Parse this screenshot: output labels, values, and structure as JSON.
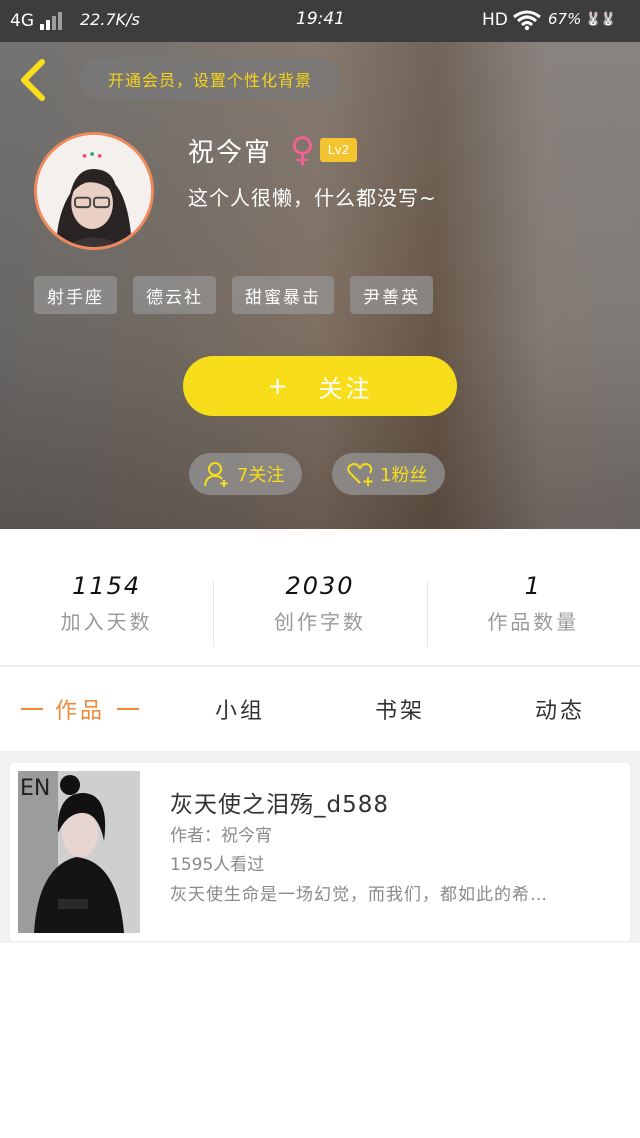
{
  "status_bar": {
    "network": "4G",
    "speed": "22.7K/s",
    "time": "19:41",
    "hd": "HD",
    "battery": "67%",
    "bunny": "🐰🐰"
  },
  "header": {
    "vip_prompt": "开通会员，设置个性化背景",
    "username": "祝今宵",
    "gender_symbol": "♀",
    "level": "Lv2",
    "bio": "这个人很懒，什么都没写~",
    "tags": [
      "射手座",
      "德云社",
      "甜蜜暴击",
      "尹善英"
    ],
    "follow_plus": "+",
    "follow_label": "关注",
    "following_count": "7关注",
    "fans_count": "1粉丝"
  },
  "stats": [
    {
      "value": "1154",
      "label": "加入天数"
    },
    {
      "value": "2030",
      "label": "创作字数"
    },
    {
      "value": "1",
      "label": "作品数量"
    }
  ],
  "tabs": [
    "作品",
    "小组",
    "书架",
    "动态"
  ],
  "works": [
    {
      "title": "灰天使之泪殇_d588",
      "author": "作者：祝今宵",
      "views": "1595人看过",
      "description": "灰天使生命是一场幻觉，而我们，都如此的希…",
      "cover_text": "EN"
    }
  ],
  "colors": {
    "accent_yellow": "#f7dd1a",
    "accent_orange": "#f08a3b",
    "gender_pink": "#f06292",
    "level_badge": "#f4c430"
  }
}
